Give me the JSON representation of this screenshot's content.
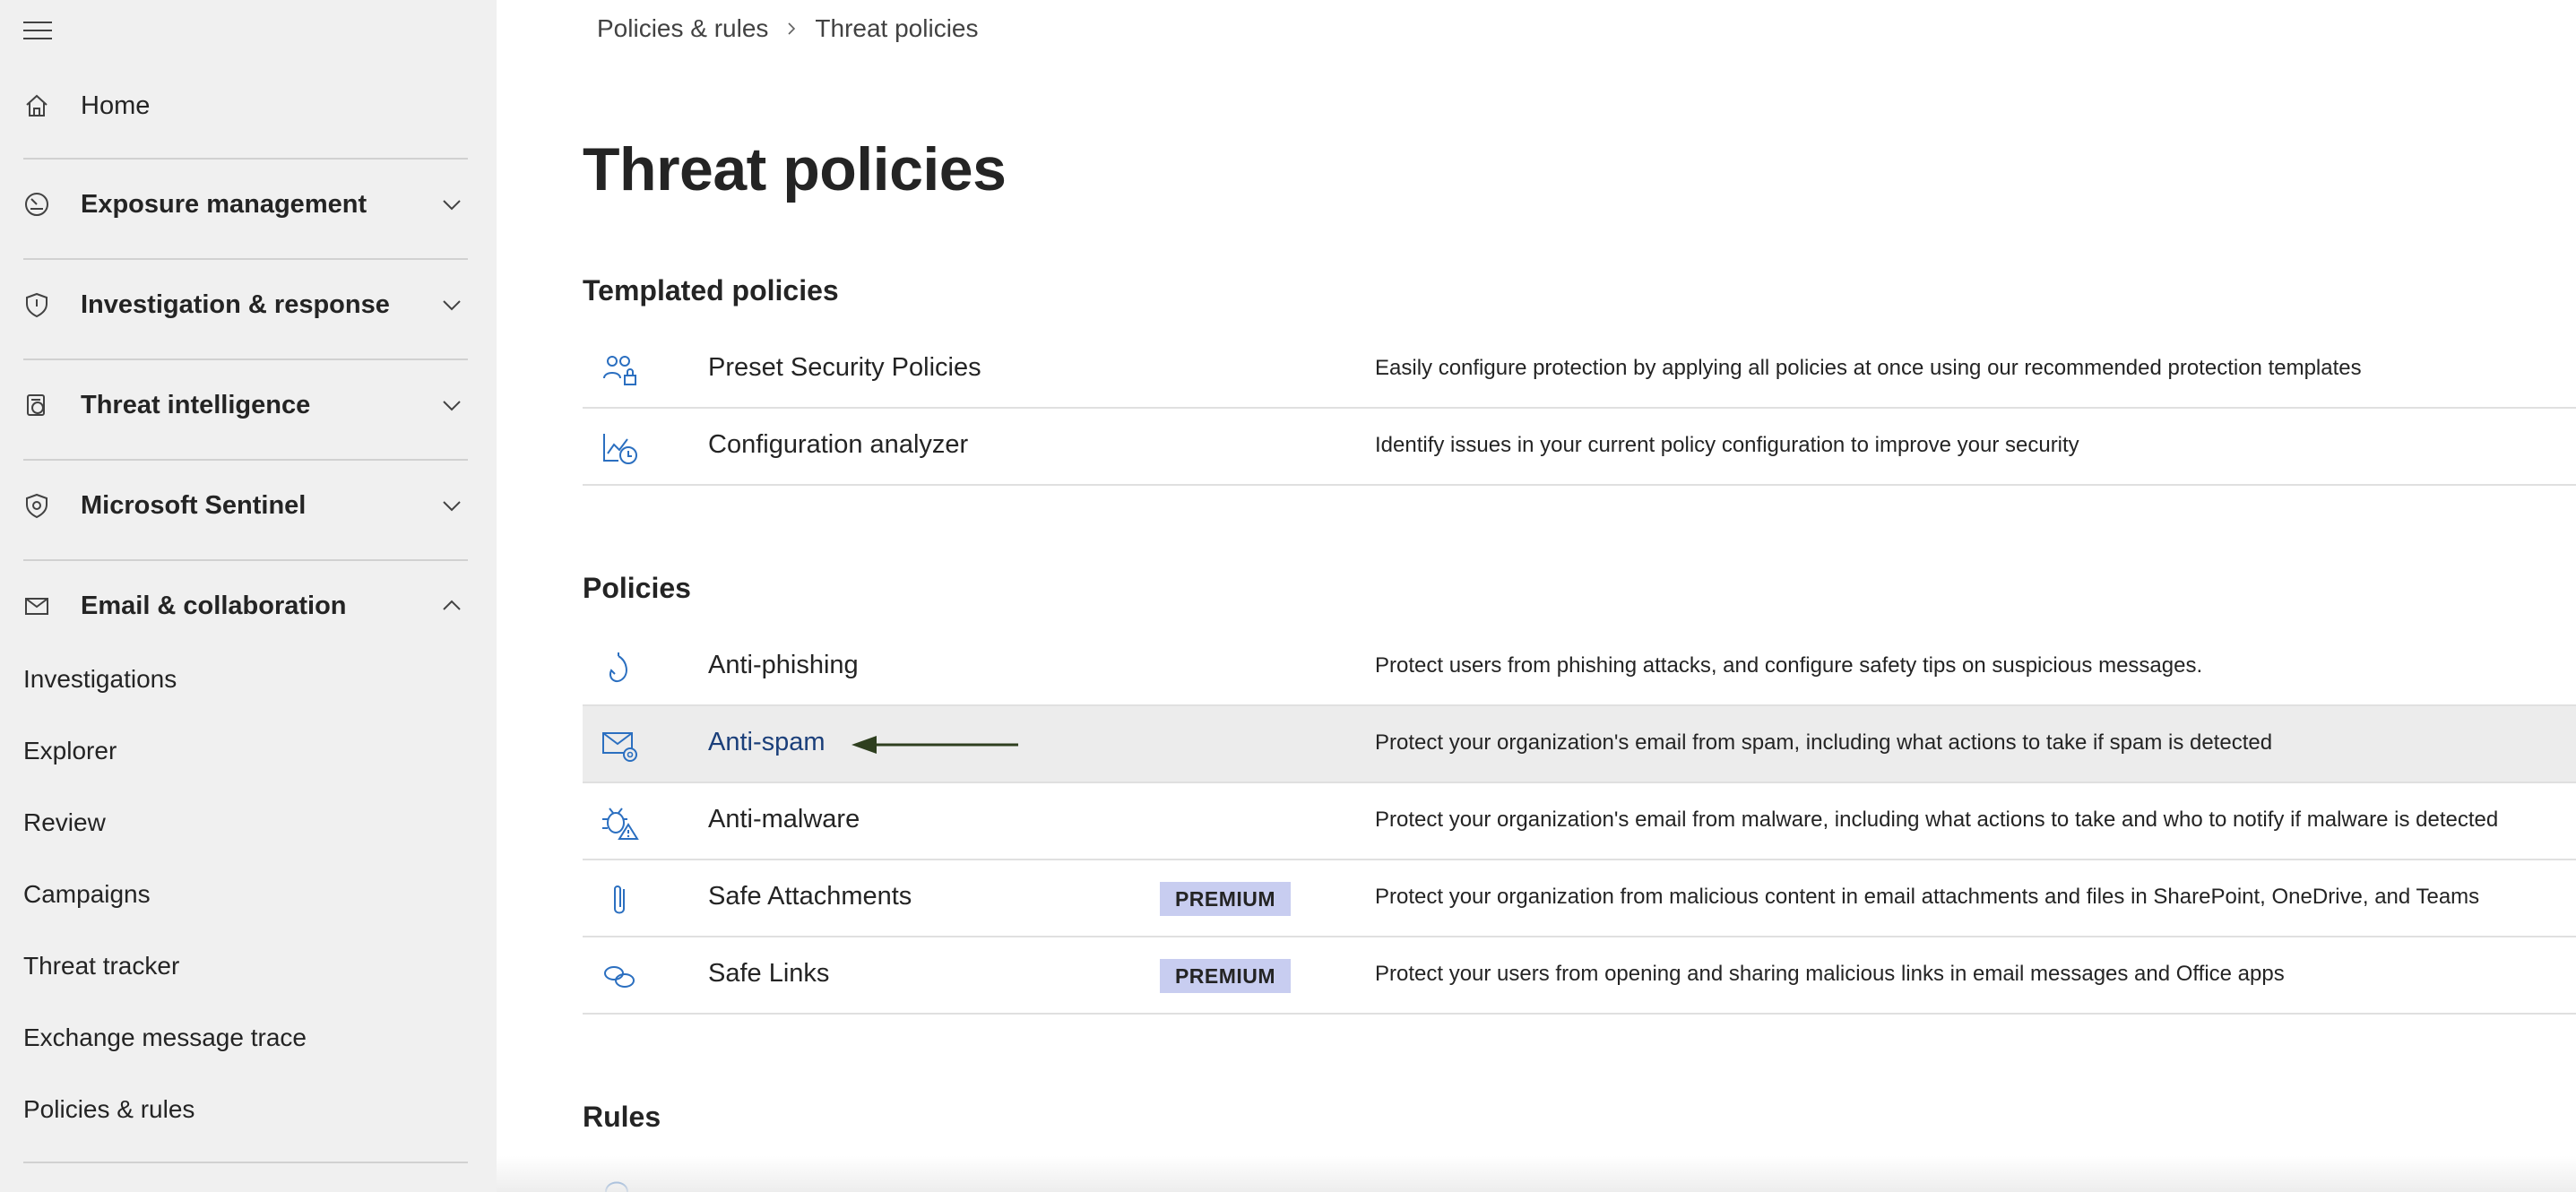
{
  "sidebar": {
    "home": "Home",
    "groups": {
      "exposure": "Exposure management",
      "investigation": "Investigation & response",
      "threat_intel": "Threat intelligence",
      "sentinel": "Microsoft Sentinel",
      "email": "Email & collaboration"
    },
    "email_items": {
      "investigations": "Investigations",
      "explorer": "Explorer",
      "review": "Review",
      "campaigns": "Campaigns",
      "threat_tracker": "Threat tracker",
      "exchange_trace": "Exchange message trace",
      "policies_rules": "Policies & rules"
    }
  },
  "breadcrumb": {
    "parent": "Policies & rules",
    "current": "Threat policies"
  },
  "page_title": "Threat policies",
  "sections": {
    "templated": {
      "title": "Templated policies",
      "preset": {
        "name": "Preset Security Policies",
        "desc": "Easily configure protection by applying all policies at once using our recommended protection templates",
        "icon": "people-lock-icon"
      },
      "config": {
        "name": "Configuration analyzer",
        "desc": "Identify issues in your current policy configuration to improve your security",
        "icon": "chart-clock-icon"
      }
    },
    "policies": {
      "title": "Policies",
      "antiphishing": {
        "name": "Anti-phishing",
        "desc": "Protect users from phishing attacks, and configure safety tips on suspicious messages.",
        "icon": "hook-icon"
      },
      "antispam": {
        "name": "Anti-spam",
        "desc": "Protect your organization's email from spam, including what actions to take if spam is detected",
        "icon": "mail-settings-icon"
      },
      "antimalware": {
        "name": "Anti-malware",
        "desc": "Protect your organization's email from malware, including what actions to take and who to notify if malware is detected",
        "icon": "bug-warning-icon"
      },
      "safeattach": {
        "name": "Safe Attachments",
        "badge": "PREMIUM",
        "desc": "Protect your organization from malicious content in email attachments and files in SharePoint, OneDrive, and Teams",
        "icon": "paperclip-icon"
      },
      "safelinks": {
        "name": "Safe Links",
        "badge": "PREMIUM",
        "desc": "Protect your users from opening and sharing malicious links in email messages and Office apps",
        "icon": "link-icon"
      }
    },
    "rules": {
      "title": "Rules"
    }
  },
  "colors": {
    "sidebar_bg": "#f0f0f0",
    "icon_blue": "#2b6fc0",
    "link_blue": "#1b3f7a",
    "badge_bg": "#c8cdf0",
    "highlight_row": "#ececec",
    "arrow": "#2e3f1f"
  }
}
